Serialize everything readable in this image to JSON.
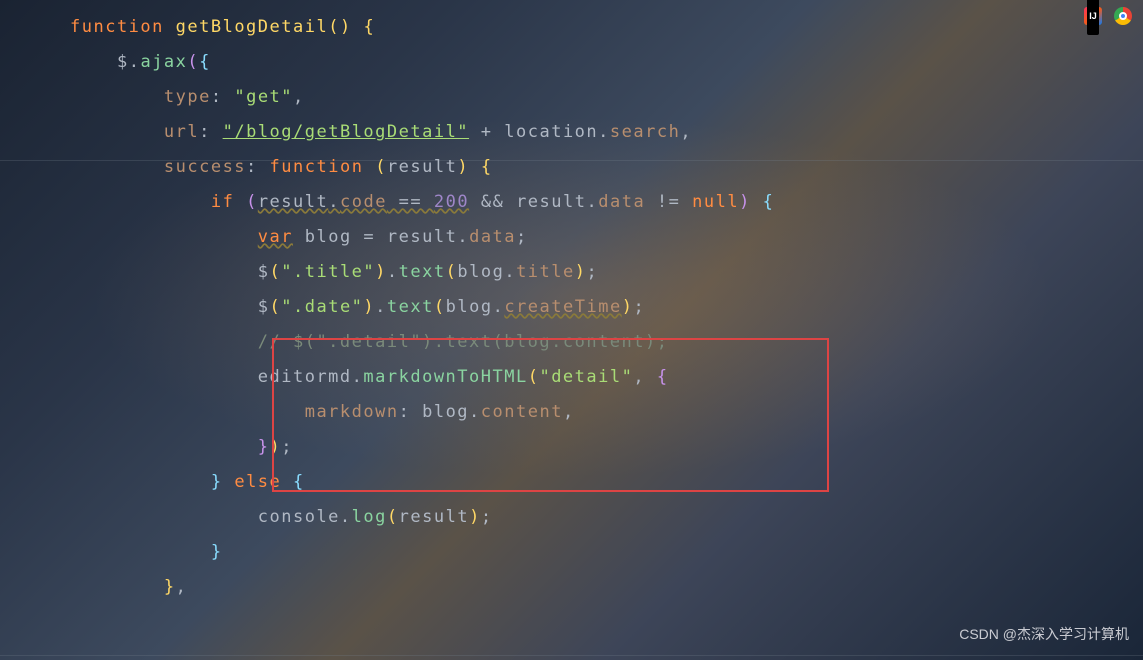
{
  "code": {
    "l1": {
      "kw": "function",
      "name": "getBlogDetail"
    },
    "l2": {
      "dollar": "$",
      "ajax": "ajax"
    },
    "l3": {
      "key": "type",
      "val": "\"get\""
    },
    "l4": {
      "key": "url",
      "val": "\"/blog/getBlogDetail\"",
      "plus": " + ",
      "obj": "location",
      "prop": "search"
    },
    "l5": {
      "key": "success",
      "fn": "function",
      "param": "result"
    },
    "l6": {
      "kw": "if",
      "r1": "result",
      "code": "code",
      "eq": " == ",
      "num": "200",
      "and": " && ",
      "r2": "result",
      "data": "data",
      "ne": " != ",
      "null": "null"
    },
    "l7": {
      "kw": "var",
      "name": "blog",
      "eq": " = ",
      "r": "result",
      "data": "data"
    },
    "l8": {
      "d": "$",
      "sel": "\".title\"",
      "text": "text",
      "obj": "blog",
      "prop": "title"
    },
    "l9": {
      "d": "$",
      "sel": "\".date\"",
      "text": "text",
      "obj": "blog",
      "prop": "createTime"
    },
    "l10": {
      "comment": "// $(\".detail\").text(blog.content);"
    },
    "l11": {
      "obj": "editormd",
      "fn": "markdownToHTML",
      "arg": "\"detail\""
    },
    "l12": {
      "key": "markdown",
      "obj": "blog",
      "prop": "content"
    },
    "l14": {
      "kw": "else"
    },
    "l15": {
      "obj": "console",
      "fn": "log",
      "arg": "result"
    }
  },
  "watermark": "CSDN @杰深入学习计算机",
  "icons": {
    "ij": "intellij-icon",
    "chrome": "chrome-icon"
  }
}
